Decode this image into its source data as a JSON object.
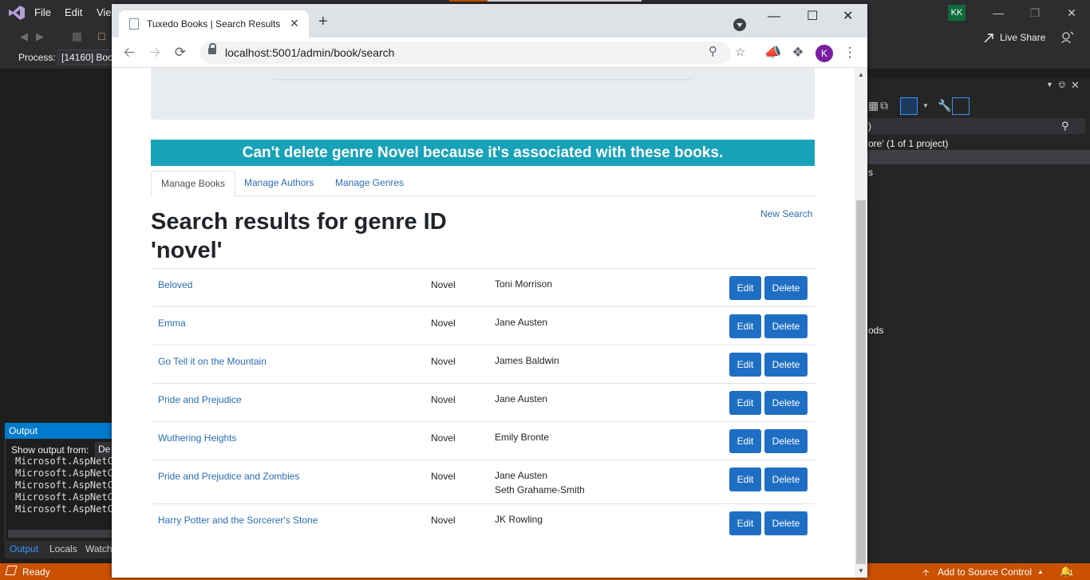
{
  "vs": {
    "menu": [
      "File",
      "Edit",
      "Vie"
    ],
    "avatar": "KK",
    "process_label": "Process:",
    "process_value": "[14160] Boo",
    "live_share": "Live Share",
    "solution": {
      "search_text": ")",
      "project_line": "ore' (1 of 1 project)",
      "item1": "s",
      "item2": "ods"
    },
    "output": {
      "title": "Output",
      "show_from_label": "Show output from:",
      "show_from_value": "De",
      "lines": [
        "Microsoft.AspNetC",
        "Microsoft.AspNetC",
        "Microsoft.AspNetC",
        "Microsoft.AspNetC",
        "Microsoft.AspNetC"
      ],
      "tabs": [
        "Output",
        "Locals",
        "Watch"
      ]
    },
    "status": {
      "ready": "Ready",
      "source_control": "Add to Source Control",
      "notifications": "1"
    },
    "colors": {
      "titlebar": "#2d2d30",
      "status": "#ca5100",
      "accent": "#007acc"
    }
  },
  "browser": {
    "tab_title": "Tuxedo Books | Search Results",
    "url": "localhost:5001/admin/book/search",
    "profile_initial": "K"
  },
  "page": {
    "alert": "Can't delete genre Novel because it's associated with these books.",
    "tabs": [
      "Manage Books",
      "Manage Authors",
      "Manage Genres"
    ],
    "heading_line1": "Search results for genre ID",
    "heading_line2": "'novel'",
    "new_search": "New Search",
    "edit_label": "Edit",
    "delete_label": "Delete",
    "books": [
      {
        "title": "Beloved",
        "genre": "Novel",
        "authors": [
          "Toni Morrison"
        ]
      },
      {
        "title": "Emma",
        "genre": "Novel",
        "authors": [
          "Jane Austen"
        ]
      },
      {
        "title": "Go Tell it on the Mountain",
        "genre": "Novel",
        "authors": [
          "James Baldwin"
        ]
      },
      {
        "title": "Pride and Prejudice",
        "genre": "Novel",
        "authors": [
          "Jane Austen"
        ]
      },
      {
        "title": "Wuthering Heights",
        "genre": "Novel",
        "authors": [
          "Emily Bronte"
        ]
      },
      {
        "title": "Pride and Prejudice and Zombies",
        "genre": "Novel",
        "authors": [
          "Jane Austen",
          "Seth Grahame-Smith"
        ]
      },
      {
        "title": "Harry Potter and the Sorcerer's Stone",
        "genre": "Novel",
        "authors": [
          "JK Rowling"
        ]
      }
    ],
    "colors": {
      "alert": "#17a2b8",
      "button": "#1e6fc4",
      "link": "#2a6db6"
    }
  }
}
